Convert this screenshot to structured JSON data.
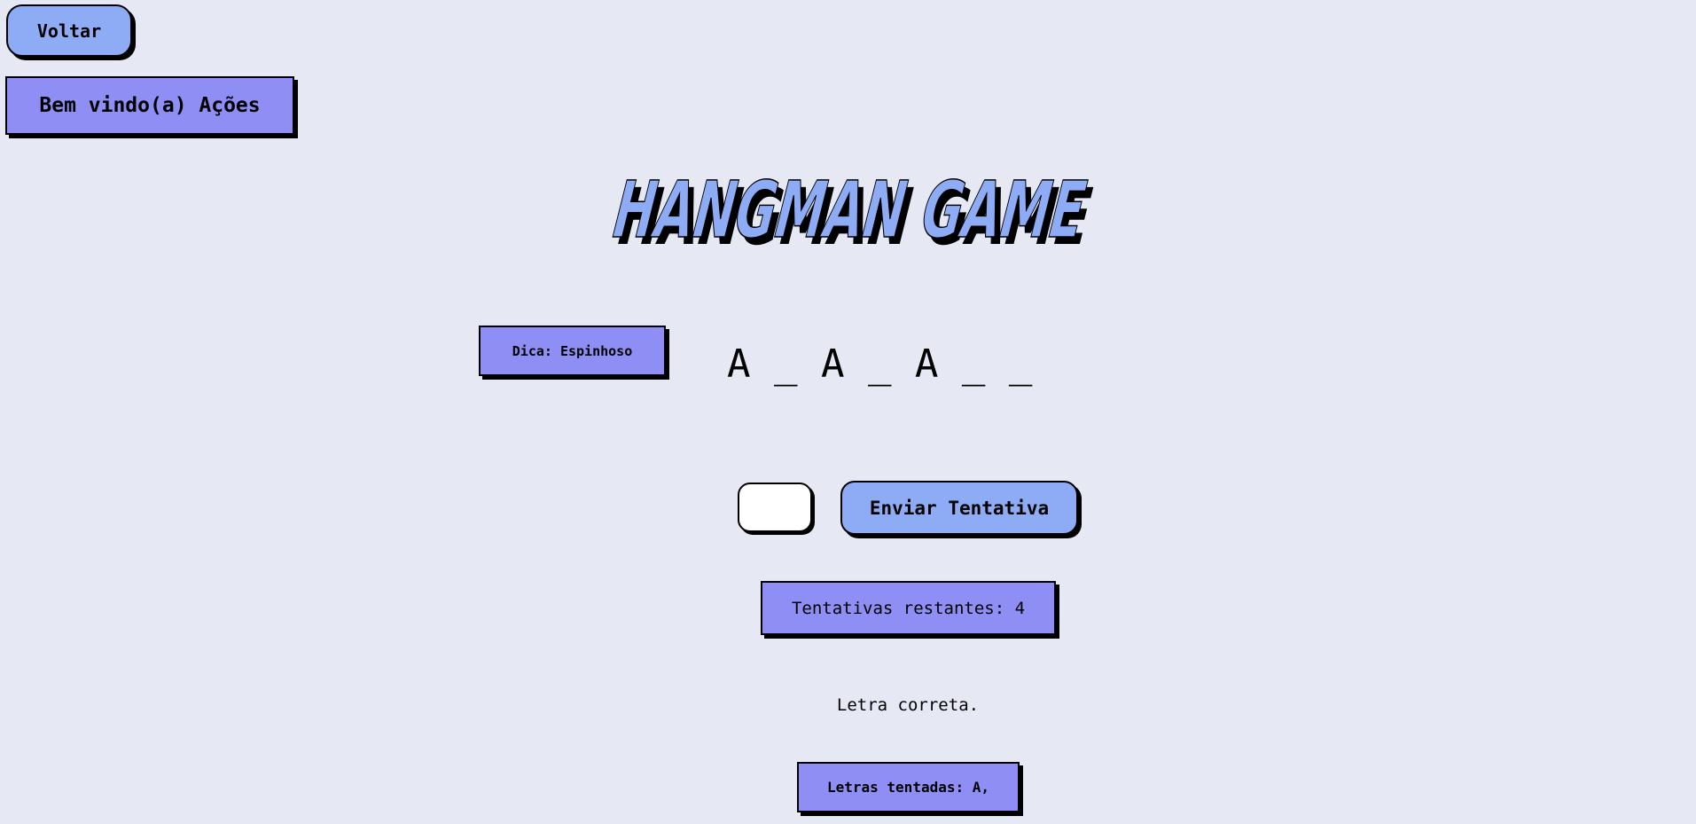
{
  "nav": {
    "back_label": "Voltar"
  },
  "header": {
    "welcome_text": "Bem vindo(a) Ações"
  },
  "game": {
    "title": "HANGMAN GAME",
    "hint": "Dica: Espinhoso",
    "masked_word": "A _ A _ A _ _",
    "guess_input_value": "",
    "submit_label": "Enviar Tentativa",
    "attempts_remaining": "Tentativas restantes: 4",
    "feedback": "Letra correta.",
    "letters_tried": "Letras tentadas: A,"
  },
  "colors": {
    "background": "#e6e9f4",
    "button_blue": "#8eacf5",
    "panel_purple": "#8f8ef5",
    "title_fill": "#8eacf5",
    "shadow": "#000000"
  }
}
